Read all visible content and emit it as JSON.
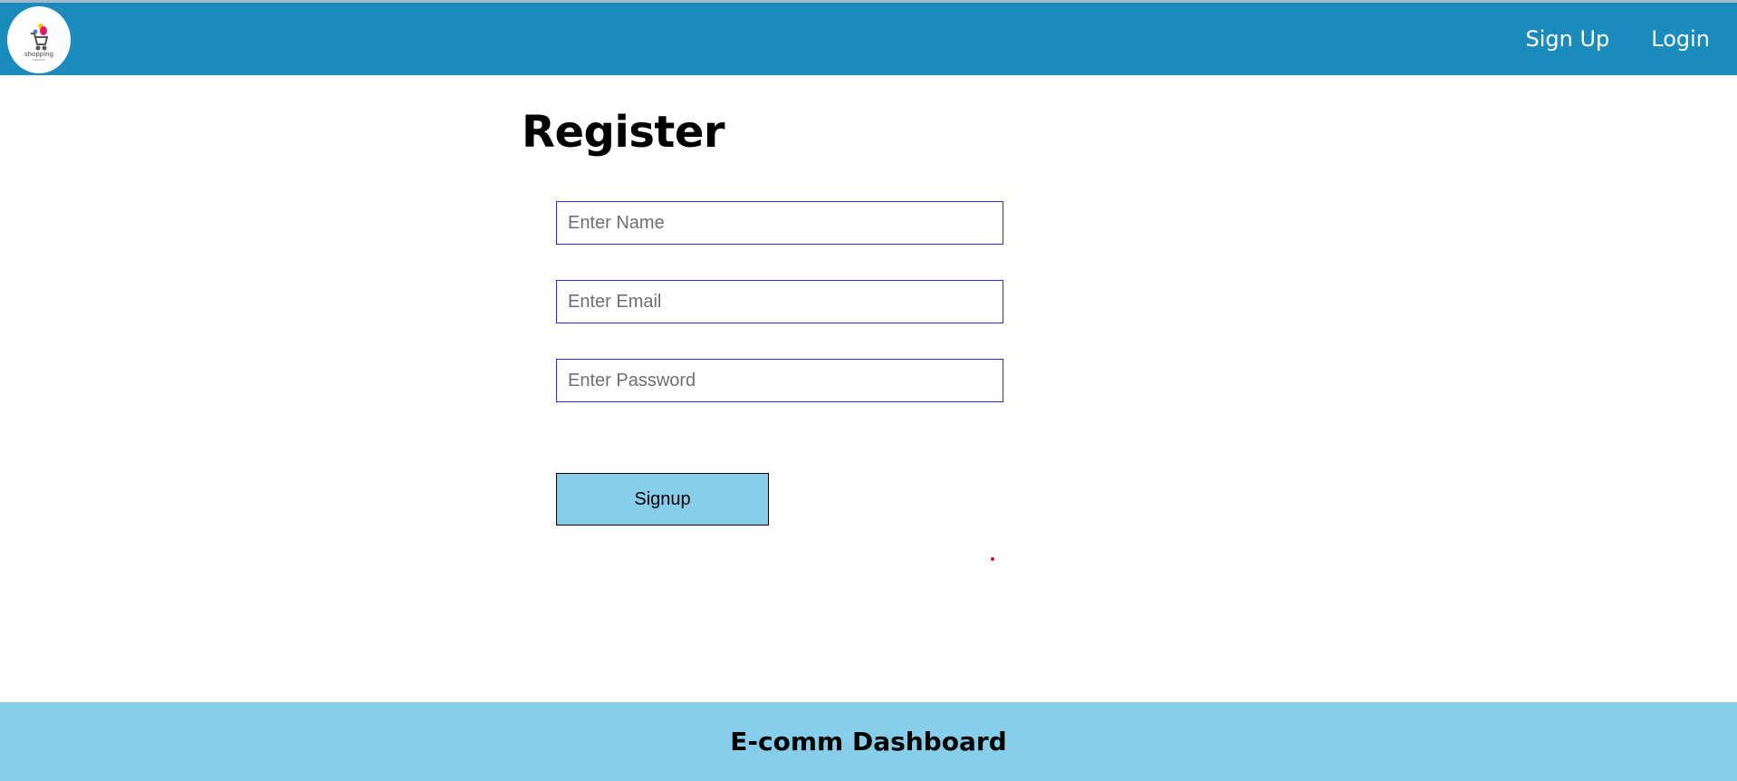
{
  "colors": {
    "navbar_bg": "#1a8bbb",
    "footer_bg": "#87ceeb",
    "button_bg": "#87ceeb",
    "input_border": "#2a27e6"
  },
  "header": {
    "logo_icon": "shopping-cart-logo-icon",
    "logo_text": "shopping",
    "nav": {
      "signup_label": "Sign Up",
      "login_label": "Login"
    }
  },
  "main": {
    "title": "Register",
    "fields": {
      "name_placeholder": "Enter Name",
      "name_value": "",
      "email_placeholder": "Enter Email",
      "email_value": "",
      "password_placeholder": "Enter Password",
      "password_value": ""
    },
    "signup_button_label": "Signup"
  },
  "footer": {
    "text": "E-comm Dashboard"
  }
}
